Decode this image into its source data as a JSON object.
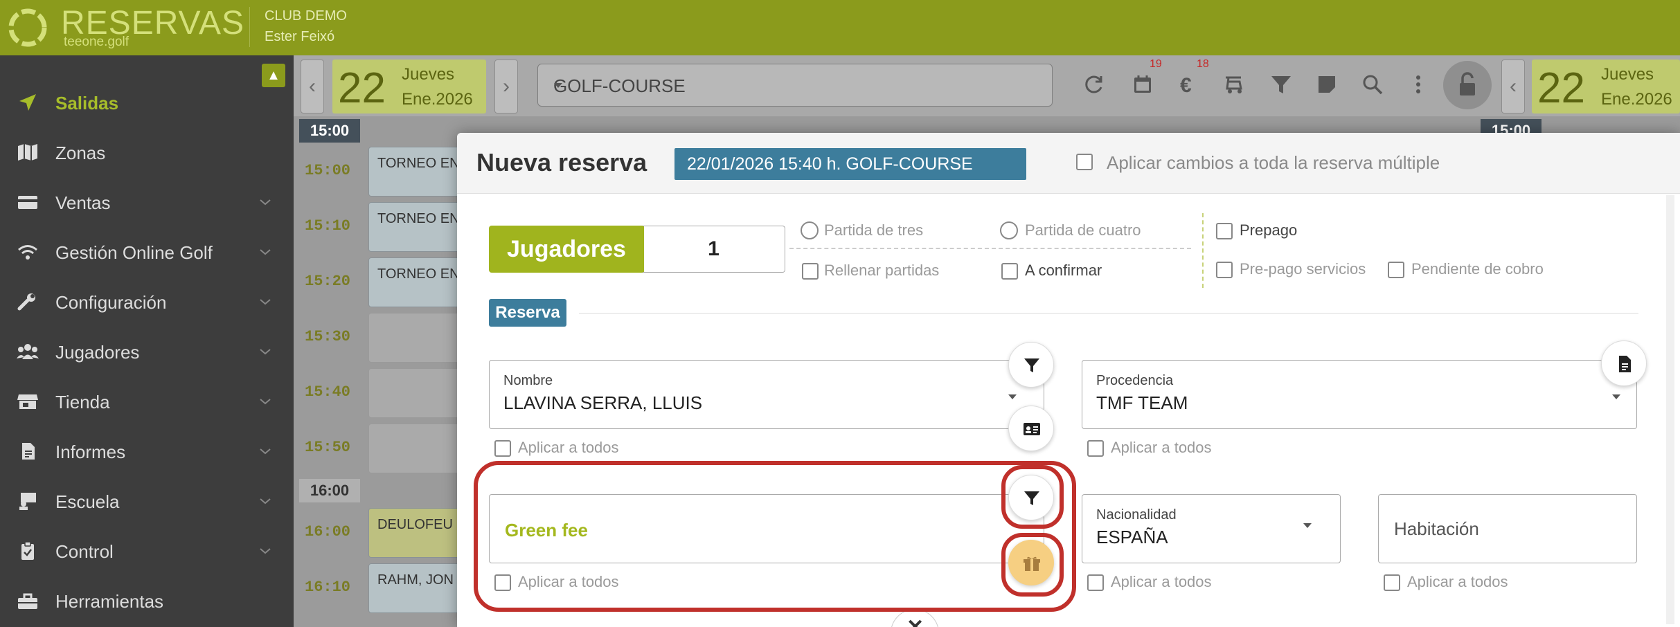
{
  "app": {
    "brand": "RESERVAS",
    "brand_sub": "teeone.golf",
    "club": "CLUB DEMO",
    "user": "Ester Feixó"
  },
  "sidebar": {
    "items": [
      {
        "label": "Salidas",
        "icon": "paper-plane-icon",
        "active": true
      },
      {
        "label": "Zonas",
        "icon": "map-icon"
      },
      {
        "label": "Ventas",
        "icon": "credit-card-icon"
      },
      {
        "label": "Gestión Online Golf",
        "icon": "wifi-icon"
      },
      {
        "label": "Configuración",
        "icon": "wrench-icon"
      },
      {
        "label": "Jugadores",
        "icon": "users-icon"
      },
      {
        "label": "Tienda",
        "icon": "store-icon"
      },
      {
        "label": "Informes",
        "icon": "report-icon"
      },
      {
        "label": "Escuela",
        "icon": "teacher-icon"
      },
      {
        "label": "Control",
        "icon": "clipboard-icon"
      },
      {
        "label": "Herramientas",
        "icon": "toolbox-icon"
      }
    ]
  },
  "schedule": {
    "date_left": {
      "day": "22",
      "weekday": "Jueves",
      "month": "Ene.2026"
    },
    "date_right": {
      "day": "22",
      "weekday": "Jueves",
      "month": "Ene.2026"
    },
    "course": "GOLF-COURSE",
    "badge_calendar": "19",
    "badge_euro": "18",
    "hour_head_1": "15:00",
    "hour_head_2": "16:00",
    "hour_head_right": "15:00",
    "rows": [
      {
        "time": "15:00",
        "entry": "TORNEO EN"
      },
      {
        "time": "15:10",
        "entry": "TORNEO EN"
      },
      {
        "time": "15:20",
        "entry": "TORNEO EN"
      },
      {
        "time": "15:30",
        "entry": ""
      },
      {
        "time": "15:40",
        "entry": ""
      },
      {
        "time": "15:50",
        "entry": ""
      },
      {
        "time": "16:00",
        "entry": "DEULOFEU"
      },
      {
        "time": "16:10",
        "entry": "RAHM, JON"
      }
    ]
  },
  "modal": {
    "title": "Nueva reserva",
    "tag": "22/01/2026   15:40 h.   GOLF-COURSE",
    "apply_multiple": "Aplicar cambios a toda la reserva múltiple",
    "players_label": "Jugadores",
    "players_value": "1",
    "options": {
      "partida_tres": "Partida de tres",
      "partida_cuatro": "Partida de cuatro",
      "rellenar": "Rellenar partidas",
      "confirmar": "A confirmar",
      "prepago": "Prepago",
      "prepago_servicios": "Pre-pago servicios",
      "pendiente": "Pendiente de cobro"
    },
    "section": "Reserva",
    "nombre": {
      "label": "Nombre",
      "value": "LLAVINA SERRA, LLUIS"
    },
    "procedencia": {
      "label": "Procedencia",
      "value": "TMF TEAM"
    },
    "green_fee": "Green fee",
    "nacionalidad": {
      "label": "Nacionalidad",
      "value": "ESPAÑA"
    },
    "habitacion": "Habitación",
    "apply_all": "Aplicar a todos"
  },
  "colors": {
    "brand_green": "#8b9b1c",
    "accent_green": "#a0b41e",
    "tag_blue": "#3d7d9c",
    "highlight_red": "#c0302b",
    "gift_orange": "#f6cf82"
  }
}
